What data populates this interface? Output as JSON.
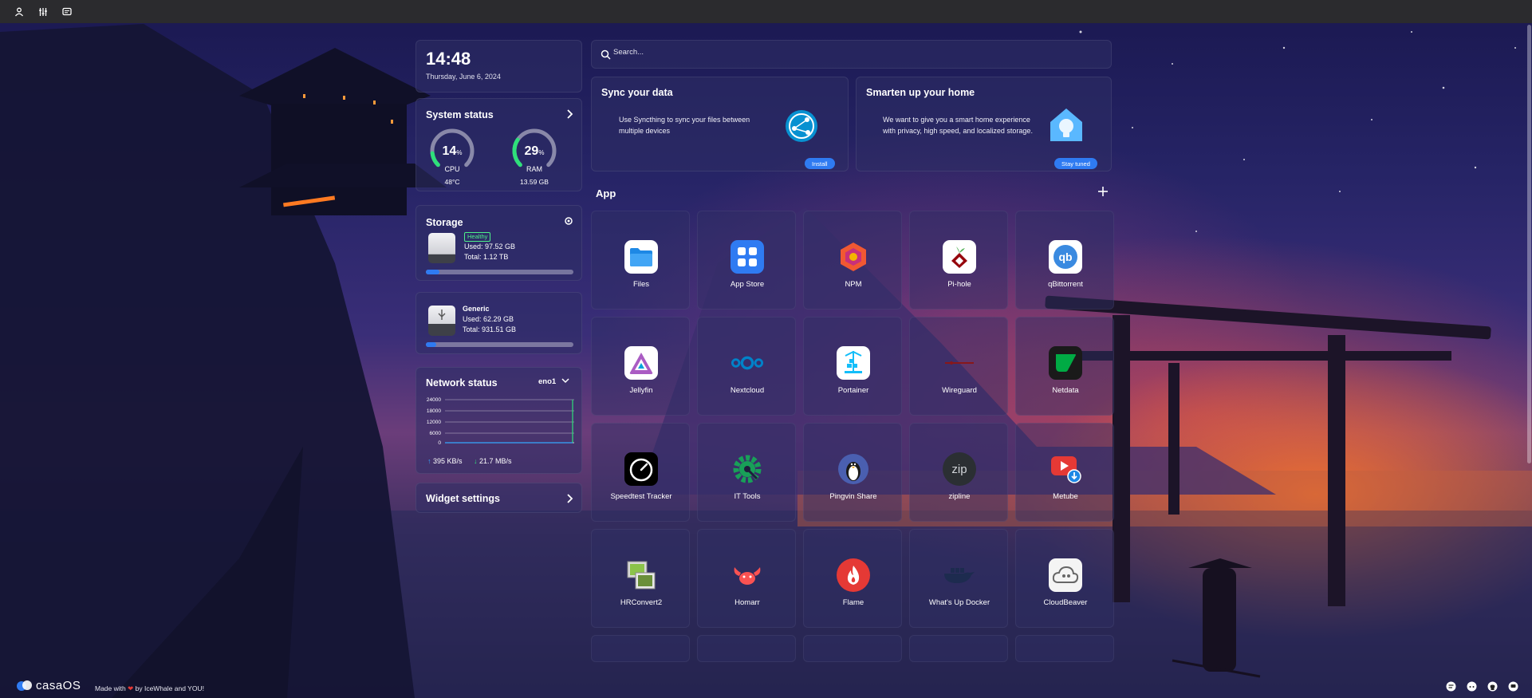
{
  "topbar": {
    "icons": [
      "user-icon",
      "sliders-icon",
      "chat-icon"
    ]
  },
  "clock": {
    "time": "14:48",
    "date": "Thursday, June 6, 2024"
  },
  "system_status": {
    "title": "System status",
    "cpu": {
      "value": "14",
      "unit": "%",
      "label": "CPU",
      "sub": "48°C",
      "percent": 14
    },
    "ram": {
      "value": "29",
      "unit": "%",
      "label": "RAM",
      "sub": "13.59 GB",
      "percent": 29
    }
  },
  "storage": {
    "title": "Storage",
    "disks": [
      {
        "badge": "Healthy",
        "used": "Used: 97.52 GB",
        "total": "Total: 1.12 TB",
        "fraction": 0.09
      },
      {
        "name": "Generic",
        "used": "Used: 62.29 GB",
        "total": "Total: 931.51 GB",
        "fraction": 0.07
      }
    ]
  },
  "network": {
    "title": "Network status",
    "interface": "eno1",
    "y_ticks": [
      "24000",
      "18000",
      "12000",
      "6000",
      "0"
    ],
    "upload": "395 KB/s",
    "download": "21.7 MB/s"
  },
  "widget_settings": {
    "label": "Widget settings"
  },
  "search": {
    "placeholder": "Search..."
  },
  "promos": [
    {
      "title": "Sync your data",
      "desc": "Use Syncthing to sync your files between multiple devices",
      "button": "Install"
    },
    {
      "title": "Smarten up your home",
      "desc": "We want to give you a smart home experience with privacy, high speed, and localized storage.",
      "button": "Stay tuned"
    }
  ],
  "apps_section": {
    "title": "App"
  },
  "apps": [
    {
      "label": "Files",
      "icon": "folder-icon",
      "color": "#1e88e5"
    },
    {
      "label": "App Store",
      "icon": "app-store-icon",
      "color": "#2f7bf2"
    },
    {
      "label": "NPM",
      "icon": "npm-icon",
      "color": "#f15833"
    },
    {
      "label": "Pi-hole",
      "icon": "pihole-icon",
      "color": "#96060c"
    },
    {
      "label": "qBittorrent",
      "icon": "qbittorrent-icon",
      "color": "#3a8ae0"
    },
    {
      "label": "Jellyfin",
      "icon": "jellyfin-icon",
      "color": "#aa5cc3"
    },
    {
      "label": "Nextcloud",
      "icon": "nextcloud-icon",
      "color": "#0082c9"
    },
    {
      "label": "Portainer",
      "icon": "portainer-icon",
      "color": "#13bef9"
    },
    {
      "label": "Wireguard",
      "icon": "wireguard-icon",
      "color": "#88171a"
    },
    {
      "label": "Netdata",
      "icon": "netdata-icon",
      "color": "#00ab44"
    },
    {
      "label": "Speedtest Tracker",
      "icon": "speedometer-icon",
      "color": "#000000"
    },
    {
      "label": "IT Tools",
      "icon": "gear-wrench-icon",
      "color": "#18a058"
    },
    {
      "label": "Pingvin Share",
      "icon": "penguin-icon",
      "color": "#4a5fb0"
    },
    {
      "label": "zipline",
      "icon": "zip-icon",
      "color": "#2b2f33"
    },
    {
      "label": "Metube",
      "icon": "youtube-download-icon",
      "color": "#e53935"
    },
    {
      "label": "HRConvert2",
      "icon": "image-convert-icon",
      "color": "#6a8f3a"
    },
    {
      "label": "Homarr",
      "icon": "homarr-icon",
      "color": "#fa5252"
    },
    {
      "label": "Flame",
      "icon": "flame-icon",
      "color": "#e53935"
    },
    {
      "label": "What's Up Docker",
      "icon": "whale-icon",
      "color": "#1d2b4f"
    },
    {
      "label": "CloudBeaver",
      "icon": "cloudbeaver-icon",
      "color": "#8a8f96"
    }
  ],
  "footer": {
    "brand": "casaOS",
    "made_with": "Made with",
    "by": "by IceWhale and YOU!",
    "icons": [
      "feedback-icon",
      "discord-icon",
      "github-icon",
      "forum-icon"
    ]
  }
}
